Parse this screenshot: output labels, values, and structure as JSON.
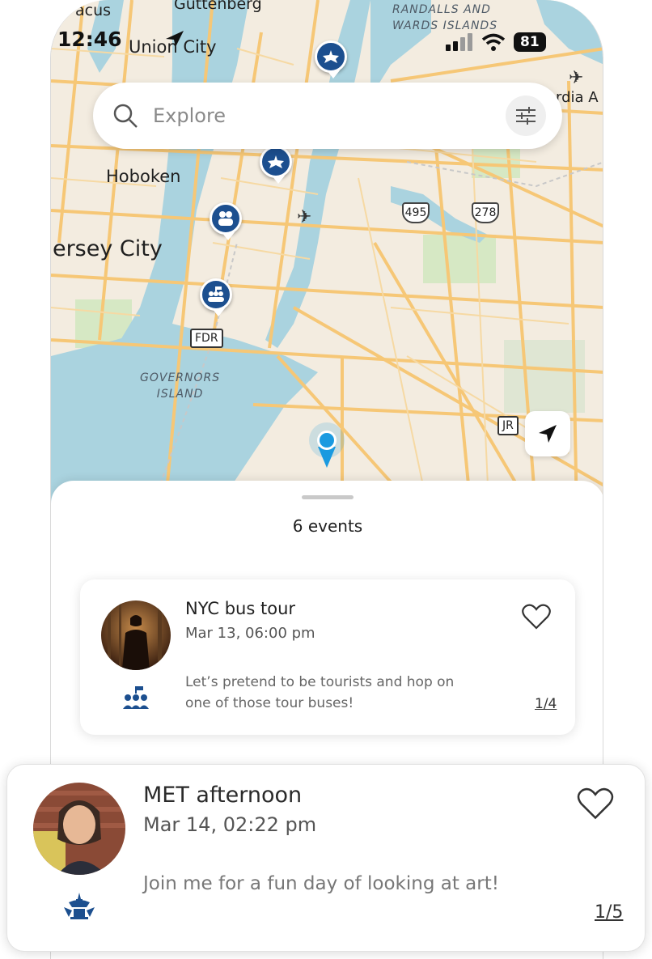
{
  "status_bar": {
    "time": "12:46",
    "battery": "81"
  },
  "map": {
    "labels": {
      "acus": "acus",
      "guttenberg": "Guttenberg",
      "union_city": "Union City",
      "randalls": "RANDALLS AND",
      "wards": "WARDS ISLANDS",
      "rdia": "rdia A",
      "hoboken": "Hoboken",
      "jersey_city": "Jersey City",
      "governors": "GOVERNORS",
      "island": "ISLAND"
    },
    "shields": {
      "fdr": "FDR",
      "jr": "JR",
      "i495": "495",
      "i278": "278"
    }
  },
  "search": {
    "placeholder": "Explore"
  },
  "sheet": {
    "events_count": "6 events"
  },
  "events": [
    {
      "title": "NYC bus tour",
      "date": "Mar 13, 06:00 pm",
      "description": "Let’s pretend to be tourists and hop on one of those tour buses!",
      "attendance": "1/4",
      "type_icon": "group-tour-icon"
    },
    {
      "title": "MET afternoon",
      "date": "Mar 14, 02:22 pm",
      "description": "Join me for a fun day of looking at art!",
      "attendance": "1/5",
      "type_icon": "museum-icon"
    }
  ],
  "colors": {
    "accent": "#1c4f8f",
    "map_water": "#aad3df",
    "map_road": "#f6c776",
    "location_blue": "#1a9ae0"
  }
}
